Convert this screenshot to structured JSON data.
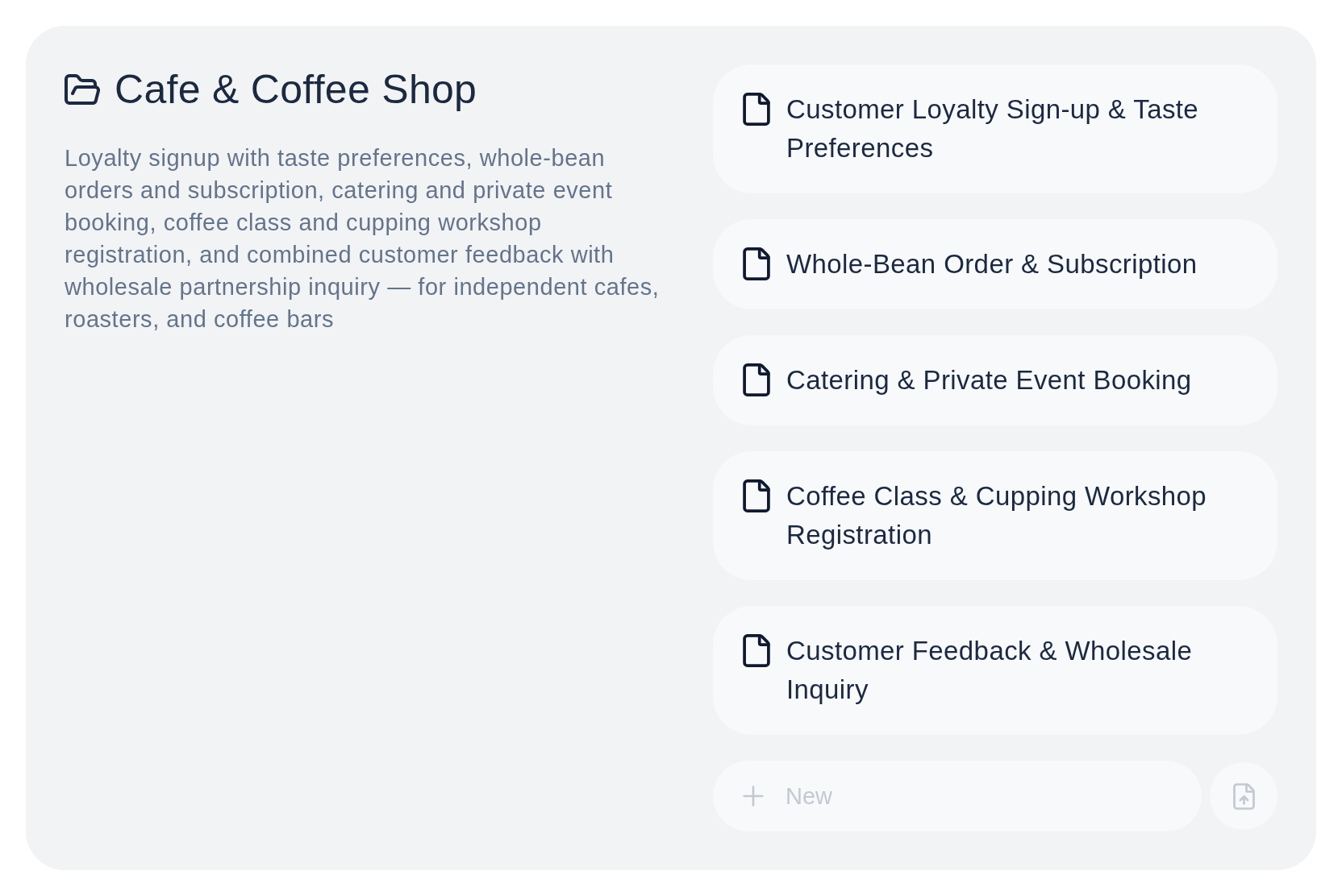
{
  "section": {
    "title": "Cafe & Coffee Shop",
    "description": "Loyalty signup with taste preferences, whole-bean orders and subscription, catering and private event booking, coffee class and cupping workshop registration, and combined customer feedback with wholesale partnership inquiry — for independent cafes, roasters, and coffee bars"
  },
  "forms": [
    "Customer Loyalty Sign-up & Taste Preferences",
    "Whole-Bean Order & Subscription",
    "Catering & Private Event Booking",
    "Coffee Class & Cupping Workshop Registration",
    "Customer Feedback & Wholesale Inquiry"
  ],
  "new_form": {
    "placeholder": "New"
  }
}
